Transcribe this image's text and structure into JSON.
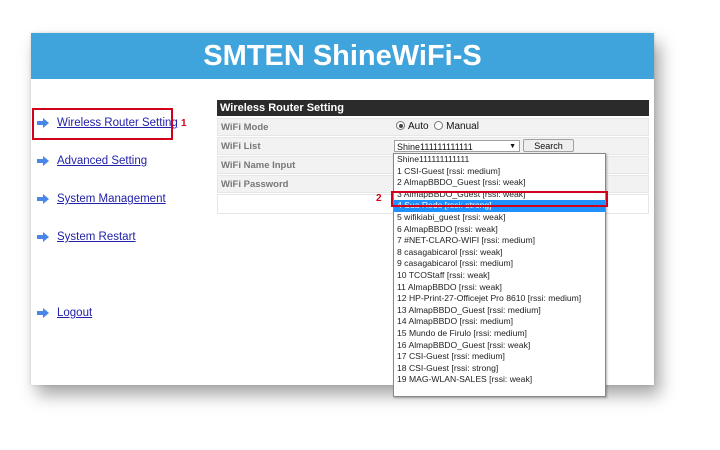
{
  "header": {
    "title": "SMTEN ShineWiFi-S"
  },
  "sidebar": {
    "items": [
      {
        "label": "Wireless Router Setting"
      },
      {
        "label": "Advanced Setting"
      },
      {
        "label": "System Management"
      },
      {
        "label": "System Restart"
      },
      {
        "label": "Logout"
      }
    ]
  },
  "markers": {
    "first": "1",
    "second": "2"
  },
  "panel": {
    "title": "Wireless Router Setting",
    "wifi_mode": {
      "label": "WiFi Mode",
      "auto": "Auto",
      "manual": "Manual",
      "selected": "Auto"
    },
    "wifi_list": {
      "label": "WiFi List",
      "selected_value": "Shine111111111111",
      "search_label": "Search"
    },
    "wifi_name": {
      "label": "WiFi Name Input"
    },
    "wifi_password": {
      "label": "WiFi Password"
    }
  },
  "dropdown": {
    "selected_index": 4,
    "options": [
      "Shine111111111111",
      "1 CSI-Guest [rssi: medium]",
      "2 AlmapBBDO_Guest [rssi: weak]",
      "3 AlmapBBDO_Guest [rssi: weak]",
      "4 Sua Rede [rssi: strong]",
      "5 wifikiabi_guest [rssi: weak]",
      "6 AlmapBBDO [rssi: weak]",
      "7 #NET-CLARO-WIFI [rssi: medium]",
      "8 casagabicarol [rssi: weak]",
      "9 casagabicarol [rssi: medium]",
      "10 TCOStaff [rssi: weak]",
      "11 AlmapBBDO [rssi: weak]",
      "12 HP-Print-27-Officejet Pro 8610 [rssi: medium]",
      "13 AlmapBBDO_Guest [rssi: medium]",
      "14 AlmapBBDO [rssi: medium]",
      "15 Mundo de Firulo [rssi: medium]",
      "16 AlmapBBDO_Guest [rssi: weak]",
      "17 CSI-Guest [rssi: medium]",
      "18 CSI-Guest [rssi: strong]",
      "19 MAG-WLAN-SALES [rssi: weak]"
    ]
  },
  "colors": {
    "header_bg": "#3fa3dc",
    "highlight": "#d0021b",
    "selection": "#1e90ff"
  }
}
